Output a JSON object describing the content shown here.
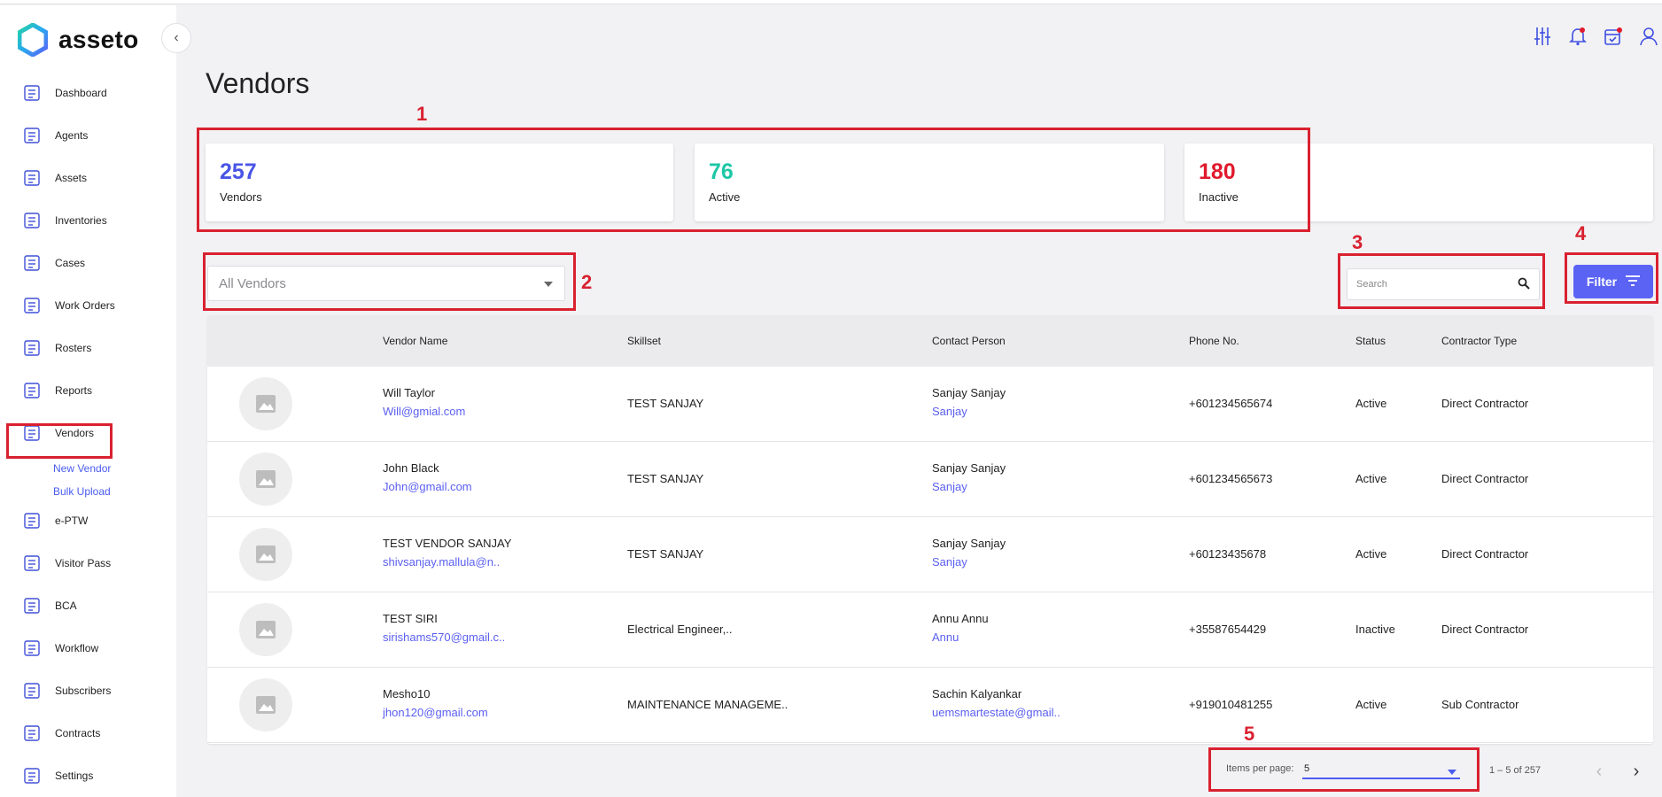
{
  "app": {
    "brand": "asseto"
  },
  "sidebar": {
    "items": [
      {
        "label": "Dashboard",
        "icon": "dashboard-icon"
      },
      {
        "label": "Agents",
        "icon": "agents-icon"
      },
      {
        "label": "Assets",
        "icon": "assets-icon"
      },
      {
        "label": "Inventories",
        "icon": "inventories-icon"
      },
      {
        "label": "Cases",
        "icon": "cases-icon"
      },
      {
        "label": "Work Orders",
        "icon": "work-orders-icon"
      },
      {
        "label": "Rosters",
        "icon": "rosters-icon"
      },
      {
        "label": "Reports",
        "icon": "reports-icon"
      },
      {
        "label": "Vendors",
        "icon": "vendors-icon"
      },
      {
        "label": "e-PTW",
        "icon": "eptw-icon"
      },
      {
        "label": "Visitor Pass",
        "icon": "visitor-pass-icon"
      },
      {
        "label": "BCA",
        "icon": "bca-icon"
      },
      {
        "label": "Workflow",
        "icon": "workflow-icon"
      },
      {
        "label": "Subscribers",
        "icon": "subscribers-icon"
      },
      {
        "label": "Contracts",
        "icon": "contracts-icon"
      },
      {
        "label": "Settings",
        "icon": "settings-icon"
      }
    ],
    "vendor_sub": [
      "New Vendor",
      "Bulk Upload"
    ]
  },
  "page": {
    "title": "Vendors"
  },
  "stats": [
    {
      "value": "257",
      "label": "Vendors",
      "color": "#4a55e6"
    },
    {
      "value": "76",
      "label": "Active",
      "color": "#1ec7a6"
    },
    {
      "value": "180",
      "label": "Inactive",
      "color": "#e0192c"
    }
  ],
  "controls": {
    "vendor_select": "All Vendors",
    "search_placeholder": "Search",
    "filter_label": "Filter"
  },
  "table": {
    "headers": [
      "Vendor Name",
      "Skillset",
      "Contact Person",
      "Phone No.",
      "Status",
      "Contractor Type"
    ],
    "rows": [
      {
        "name": "Will Taylor",
        "email": "Will@gmial.com",
        "skillset": "TEST SANJAY",
        "contact": "Sanjay Sanjay",
        "contact_sub": "Sanjay",
        "phone": "+601234565674",
        "status": "Active",
        "type": "Direct Contractor"
      },
      {
        "name": "John Black",
        "email": "John@gmail.com",
        "skillset": "TEST SANJAY",
        "contact": "Sanjay Sanjay",
        "contact_sub": "Sanjay",
        "phone": "+601234565673",
        "status": "Active",
        "type": "Direct Contractor"
      },
      {
        "name": "TEST VENDOR SANJAY",
        "email": "shivsanjay.mallula@n..",
        "skillset": "TEST SANJAY",
        "contact": "Sanjay Sanjay",
        "contact_sub": "Sanjay",
        "phone": "+60123435678",
        "status": "Active",
        "type": "Direct Contractor"
      },
      {
        "name": "TEST SIRI",
        "email": "sirishams570@gmail.c..",
        "skillset": "Electrical Engineer,..",
        "contact": "Annu Annu",
        "contact_sub": "Annu",
        "phone": "+35587654429",
        "status": "Inactive",
        "type": "Direct Contractor"
      },
      {
        "name": "Mesho10",
        "email": "jhon120@gmail.com",
        "skillset": "MAINTENANCE MANAGEME..",
        "contact": "Sachin Kalyankar",
        "contact_sub": "uemsmartestate@gmail..",
        "phone": "+919010481255",
        "status": "Active",
        "type": "Sub Contractor"
      }
    ]
  },
  "pager": {
    "items_label": "Items per page:",
    "items_value": "5",
    "range": "1 – 5 of 257"
  },
  "annotations": [
    "1",
    "2",
    "3",
    "4",
    "5"
  ],
  "colors": {
    "accent": "#5b63f5",
    "annotation": "#d92130"
  }
}
